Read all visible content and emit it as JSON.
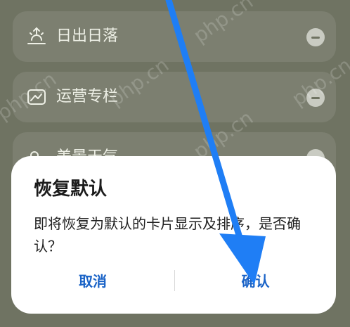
{
  "list": {
    "items": [
      {
        "label": "日出日落",
        "icon": "sunrise-icon"
      },
      {
        "label": "运营专栏",
        "icon": "image-card-icon"
      },
      {
        "label": "美景天气",
        "icon": "weather-icon"
      }
    ]
  },
  "dialog": {
    "title": "恢复默认",
    "message": "即将恢复为默认的卡片显示及排序，是否确认？",
    "cancel_label": "取消",
    "confirm_label": "确认"
  },
  "watermark": "php.cn",
  "colors": {
    "background": "#6f7362",
    "card": "#7c7f70",
    "accent": "#1a63c7",
    "arrow": "#1f7ef5"
  }
}
